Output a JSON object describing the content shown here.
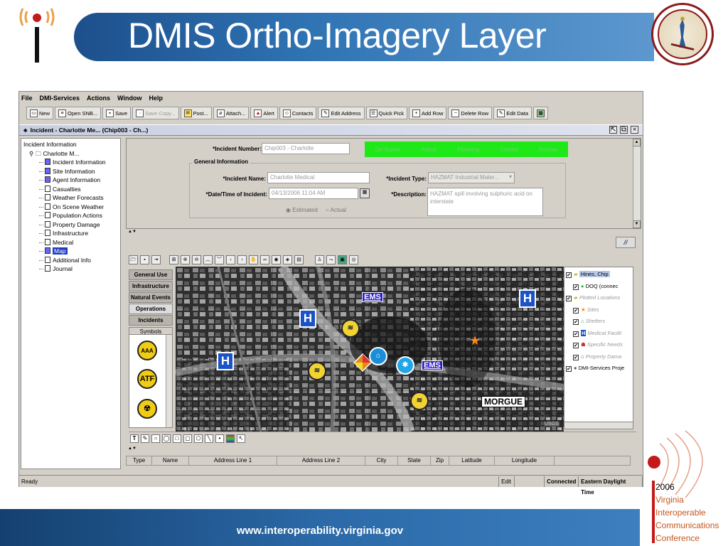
{
  "slide": {
    "title": "DMIS Ortho-Imagery Layer",
    "footer_url": "www.interoperability.virginia.gov",
    "conference": {
      "year": "2006",
      "line1": "Virginia",
      "line2": "Interoperable",
      "line3": "Communications",
      "line4": "Conference"
    },
    "seal_text": "VIRGINIA · SEMPER TYRANNIS"
  },
  "menu": [
    "File",
    "DMI-Services",
    "Actions",
    "Window",
    "Help"
  ],
  "toolbar": [
    {
      "label": "New",
      "icon": "new-icon",
      "enabled": true
    },
    {
      "label": "Open SNB...",
      "icon": "open-snb-icon",
      "enabled": true
    },
    {
      "label": "Save",
      "icon": "save-icon",
      "enabled": true
    },
    {
      "label": "Save Copy...",
      "icon": "save-copy-icon",
      "enabled": false
    },
    {
      "label": "Post...",
      "icon": "post-icon",
      "enabled": true
    },
    {
      "label": "Attach...",
      "icon": "attach-icon",
      "enabled": true
    },
    {
      "label": "Alert",
      "icon": "alert-icon",
      "enabled": true
    },
    {
      "label": "Contacts",
      "icon": "contacts-icon",
      "enabled": true
    },
    {
      "label": "Edit Address",
      "icon": "edit-address-icon",
      "enabled": true
    },
    {
      "label": "Quick Pick",
      "icon": "quick-pick-icon",
      "enabled": true
    },
    {
      "label": "Add Row",
      "icon": "add-row-icon",
      "enabled": true
    },
    {
      "label": "Delete Row",
      "icon": "delete-row-icon",
      "enabled": true
    },
    {
      "label": "Edit Data",
      "icon": "edit-data-icon",
      "enabled": true
    }
  ],
  "window_title": "Incident - Charlotte Me... (Chip003 - Ch...)",
  "tree": {
    "root": "Incident Information",
    "incident": "Charlotte M...",
    "items": [
      "Incident Information",
      "Site Information",
      "Agent Information",
      "Casualties",
      "Weather Forecasts",
      "On Scene Weather",
      "Population Actions",
      "Property Damage",
      "Infrastructure",
      "Medical",
      "Map",
      "Additional Info",
      "Journal"
    ],
    "selected": "Map"
  },
  "form": {
    "incident_number_label": "*Incident Number:",
    "incident_number": "Chip003 - Charlotte",
    "group_title": "General Information",
    "incident_name_label": "*Incident Name:",
    "incident_name": "Charlotte Medical",
    "incident_type_label": "*Incident Type:",
    "incident_type": "HAZMAT Industrial Mater...",
    "datetime_label": "*Date/Time of Incident:",
    "datetime": "04/13/2006 11:04 AM",
    "description_label": "*Description:",
    "description": "HAZMAT spill involving sulphuric acid on interstate",
    "radio_estimated": "Estimated",
    "radio_actual": "Actual",
    "status_bar_items": [
      "On Scene",
      "Active",
      "Planning",
      "Closed",
      "Archive"
    ],
    "status_color": "#1ee818"
  },
  "map_tabs": [
    "General Use",
    "Infrastructure",
    "Natural Events",
    "Operations",
    "Incidents"
  ],
  "active_map_tab": "Operations",
  "symbols_label": "Symbols",
  "symbols": [
    "AAA",
    "ATF",
    ""
  ],
  "legend": [
    {
      "label": "Hines, Chip",
      "type": "folder",
      "checked": true,
      "highlight": true
    },
    {
      "label": "DOQ (connec",
      "type": "green-dot",
      "checked": true
    },
    {
      "label": "Plotted Locations",
      "type": "folder",
      "checked": true,
      "italic": true
    },
    {
      "label": "Sites",
      "type": "star",
      "checked": true,
      "italic": true
    },
    {
      "label": "Shelters",
      "type": "shelter",
      "checked": true,
      "italic": true
    },
    {
      "label": "Medical Facilit",
      "type": "h",
      "checked": true,
      "italic": true
    },
    {
      "label": "Specific Needs",
      "type": "people",
      "checked": true,
      "italic": true
    },
    {
      "label": "Property Dama",
      "type": "house",
      "checked": true,
      "italic": true
    },
    {
      "label": "DMI-Services Proje",
      "type": "dot",
      "checked": true
    }
  ],
  "map_labels": {
    "ems1": "EMS",
    "ems2": "EMS",
    "morgue": "MORGUE",
    "h": "H",
    "usgs": "USGS"
  },
  "table_columns": [
    "Type",
    "Name",
    "Address Line 1",
    "Address Line 2",
    "City",
    "State",
    "Zip",
    "Latitude",
    "Longitude"
  ],
  "statusbar": {
    "status": "Ready",
    "edit": "Edit",
    "connection": "Connected",
    "timezone": "Eastern Daylight Time"
  }
}
